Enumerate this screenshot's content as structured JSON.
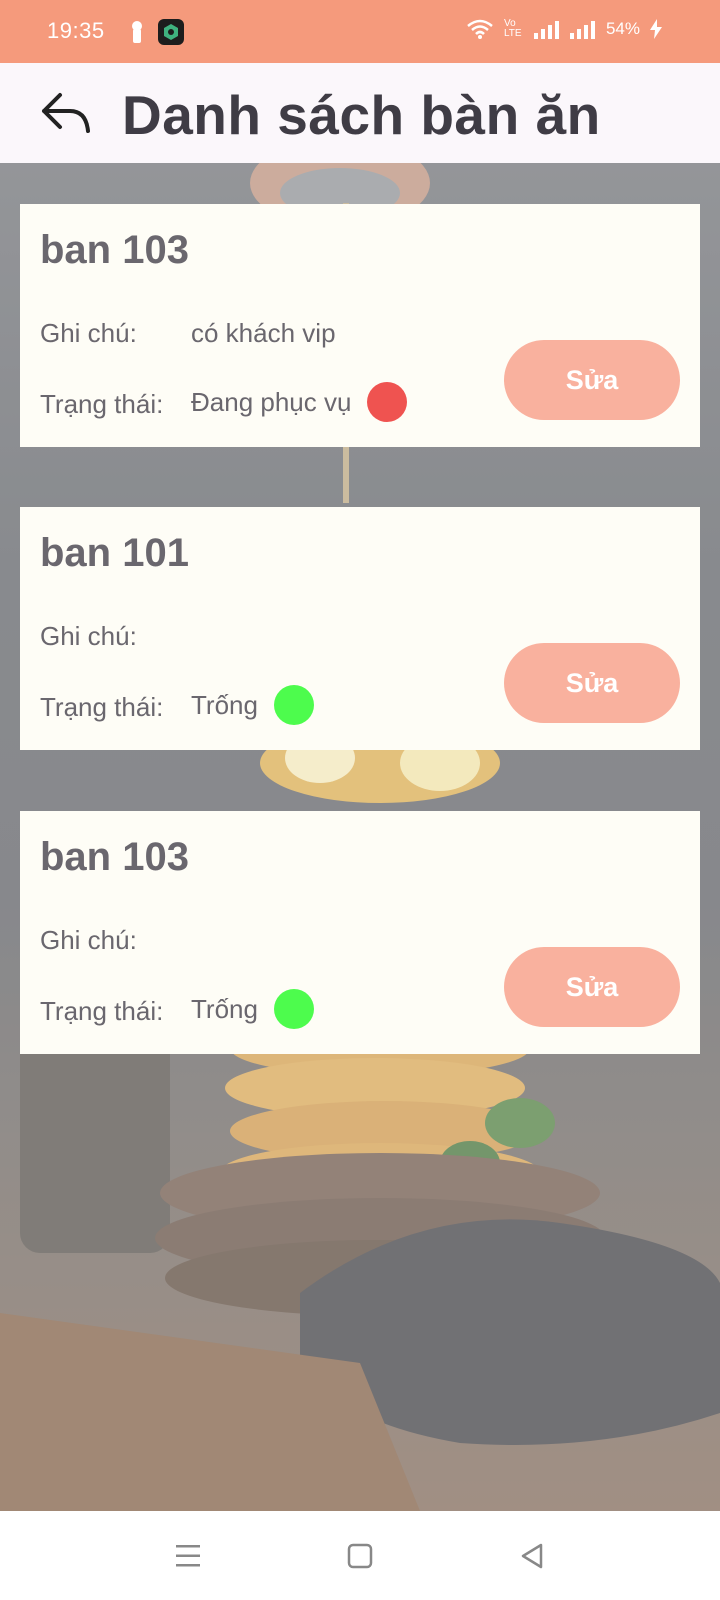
{
  "status_bar": {
    "time": "19:35",
    "battery": "54%",
    "network_label": "Vo LTE"
  },
  "header": {
    "title": "Danh sách bàn ăn",
    "back_icon": "reply-arrow-icon"
  },
  "labels": {
    "note": "Ghi chú:",
    "status": "Trạng thái:",
    "edit": "Sửa"
  },
  "tables": [
    {
      "name": "ban 103",
      "note": "có khách vip",
      "status": "Đang phục vụ",
      "status_color": "#ef5350"
    },
    {
      "name": "ban 101",
      "note": "",
      "status": "Trống",
      "status_color": "#4dfc4d"
    },
    {
      "name": "ban 103",
      "note": "",
      "status": "Trống",
      "status_color": "#4dfc4d"
    }
  ],
  "colors": {
    "status_bar": "#f59a7c",
    "edit_button": "#f9b19e",
    "card_bg": "#fefdf6"
  }
}
